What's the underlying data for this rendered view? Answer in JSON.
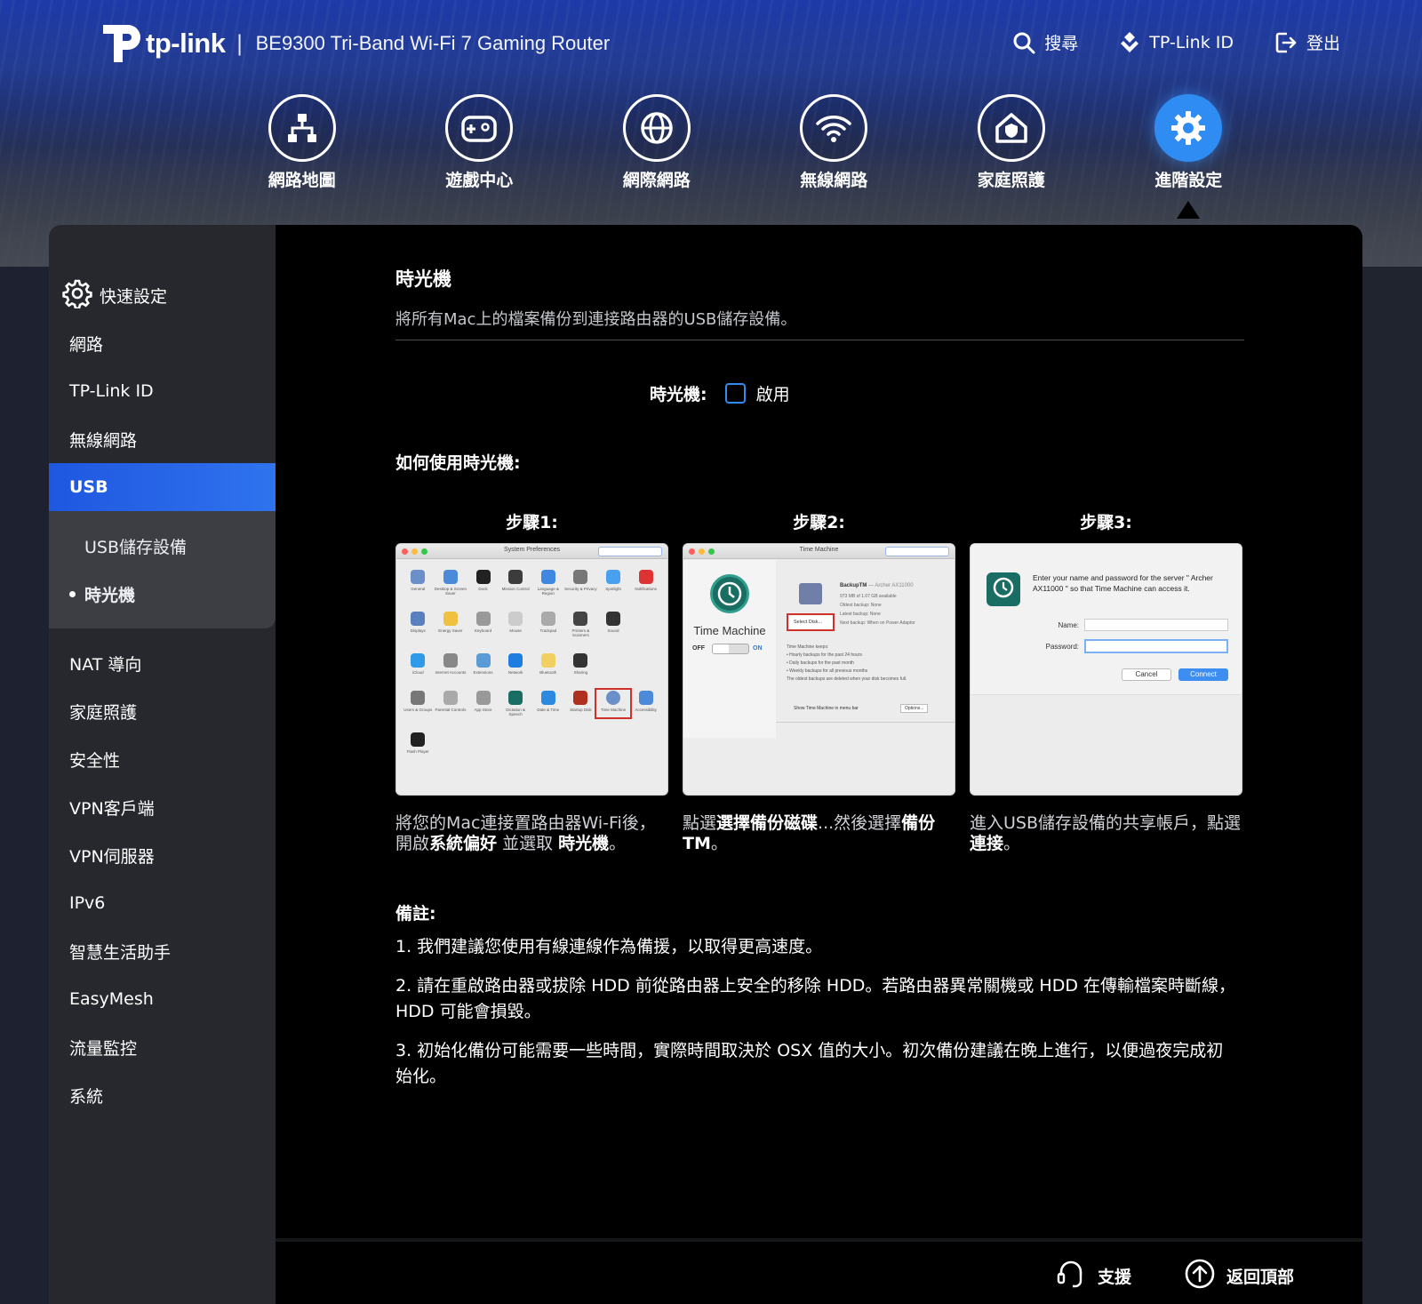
{
  "header": {
    "brand": "tp-link",
    "separator": "|",
    "model": "BE9300 Tri-Band Wi-Fi 7 Gaming Router",
    "actions": [
      {
        "label": "搜尋",
        "icon": "search-icon"
      },
      {
        "label": "TP-Link ID",
        "icon": "tplink-id-icon"
      },
      {
        "label": "登出",
        "icon": "logout-icon"
      }
    ]
  },
  "mainnav": [
    {
      "label": "網路地圖",
      "icon": "network-map-icon"
    },
    {
      "label": "遊戲中心",
      "icon": "gamepad-icon"
    },
    {
      "label": "網際網路",
      "icon": "globe-icon"
    },
    {
      "label": "無線網路",
      "icon": "wifi-icon"
    },
    {
      "label": "家庭照護",
      "icon": "home-shield-icon"
    },
    {
      "label": "進階設定",
      "icon": "gear-icon",
      "active": true
    }
  ],
  "sidebar": {
    "items": [
      {
        "label": "快速設定"
      },
      {
        "label": "網路"
      },
      {
        "label": "TP-Link ID"
      },
      {
        "label": "無線網路"
      },
      {
        "label": "USB"
      },
      {
        "label": "NAT 導向"
      },
      {
        "label": "家庭照護"
      },
      {
        "label": "安全性"
      },
      {
        "label": "VPN客戶端"
      },
      {
        "label": "VPN伺服器"
      },
      {
        "label": "IPv6"
      },
      {
        "label": "智慧生活助手"
      },
      {
        "label": "EasyMesh"
      },
      {
        "label": "流量監控"
      },
      {
        "label": "系統"
      }
    ],
    "usb_sub": [
      {
        "label": "USB儲存設備"
      },
      {
        "label": "時光機"
      }
    ]
  },
  "content": {
    "title": "時光機",
    "description": "將所有Mac上的檔案備份到連接路由器的USB儲存設備。",
    "toggle_label": "時光機:",
    "toggle_option": "啟用",
    "enabled": false,
    "howto_title": "如何使用時光機:",
    "steps": [
      {
        "title": "步驟1:",
        "caption_parts": [
          "將您的Mac連接置路由器Wi-Fi後，開啟",
          "系統偏好",
          " 並選取 ",
          "時光機",
          "。"
        ]
      },
      {
        "title": "步驟2:",
        "caption_parts": [
          "點選",
          "選擇備份磁碟",
          "...然後選擇",
          "備份TM",
          "。"
        ]
      },
      {
        "title": "步驟3:",
        "caption_parts": [
          "進入USB儲存設備的共享帳戶，點選",
          "連接",
          "。"
        ]
      }
    ],
    "step1_screen": {
      "title": "System Preferences",
      "rows": [
        [
          "General",
          "Desktop & Screen Saver",
          "Dock",
          "Mission Control",
          "Language & Region",
          "Security & Privacy",
          "Spotlight",
          "Notifications"
        ],
        [
          "Displays",
          "Energy Saver",
          "Keyboard",
          "Mouse",
          "Trackpad",
          "Printers & Scanners",
          "Sound",
          ""
        ],
        [
          "iCloud",
          "Internet Accounts",
          "Extensions",
          "Network",
          "Bluetooth",
          "Sharing",
          "",
          ""
        ],
        [
          "Users & Groups",
          "Parental Controls",
          "App Store",
          "Dictation & Speech",
          "Date & Time",
          "Startup Disk",
          "Time Machine",
          "Accessibility"
        ],
        [
          "Flash Player"
        ]
      ]
    },
    "step2_screen": {
      "title": "Time Machine",
      "app_name": "Time Machine",
      "off": "OFF",
      "on": "ON",
      "disk_name": "BackupTM",
      "disk_sub": "— Archer AX11000",
      "disk_lines": [
        "973 MB of 1.07 GB available",
        "Oldest backup: None",
        "Latest backup: None",
        "Next backup: When on Power Adaptor"
      ],
      "select_disk": "Select Disk...",
      "keeps_title": "Time Machine keeps:",
      "keeps": [
        "• Hourly backups for the past 24 hours",
        "• Daily backups for the past month",
        "• Weekly backups for all previous months"
      ],
      "keeps_note": "The oldest backups are deleted when your disk becomes full.",
      "show_menubar": "Show Time Machine in menu bar",
      "options": "Options..."
    },
    "step3_screen": {
      "prompt": "Enter your name and password for the server \" Archer AX11000 \" so that Time Machine can access it.",
      "name_label": "Name:",
      "password_label": "Password:",
      "cancel": "Cancel",
      "connect": "Connect"
    },
    "notes_title": "備註:",
    "notes": [
      "1. 我們建議您使用有線連線作為備援，以取得更高速度。",
      "2. 請在重啟路由器或拔除 HDD 前從路由器上安全的移除 HDD。若路由器異常關機或 HDD 在傳輸檔案時斷線，HDD 可能會損毀。",
      "3. 初始化備份可能需要一些時間，實際時間取決於 OSX 值的大小。初次備份建議在晚上進行，以便過夜完成初始化。"
    ]
  },
  "footer": {
    "support": "支援",
    "back_to_top": "返回頂部"
  },
  "colors": {
    "accent": "#2f8cf2",
    "usb_active": "#1f57e0",
    "content_bg": "#000000",
    "sidebar_bg": "#26282d"
  }
}
